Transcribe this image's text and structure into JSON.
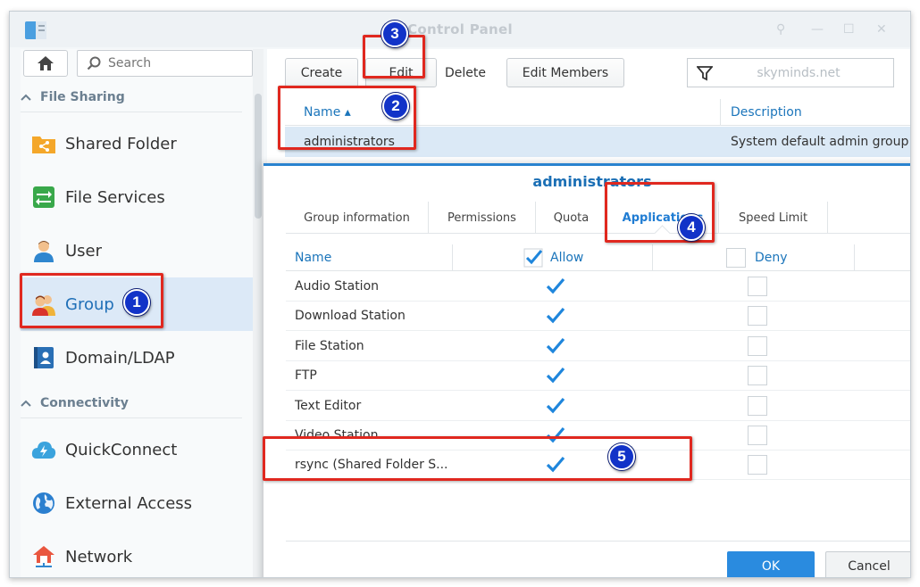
{
  "window": {
    "title": "Control Panel"
  },
  "sidebar": {
    "search_placeholder": "Search",
    "sections": [
      {
        "label": "File Sharing"
      },
      {
        "label": "Connectivity"
      }
    ],
    "items": [
      {
        "label": "Shared Folder",
        "icon": "shared-folder-icon"
      },
      {
        "label": "File Services",
        "icon": "file-services-icon"
      },
      {
        "label": "User",
        "icon": "user-icon"
      },
      {
        "label": "Group",
        "icon": "group-icon",
        "active": true
      },
      {
        "label": "Domain/LDAP",
        "icon": "domain-ldap-icon"
      },
      {
        "label": "QuickConnect",
        "icon": "quickconnect-icon"
      },
      {
        "label": "External Access",
        "icon": "globe-icon"
      },
      {
        "label": "Network",
        "icon": "network-icon"
      }
    ]
  },
  "toolbar": {
    "create": "Create",
    "edit": "Edit",
    "delete": "Delete",
    "edit_members": "Edit Members",
    "filter_value": "skyminds.net"
  },
  "group_grid": {
    "columns": {
      "name": "Name ▴",
      "description": "Description"
    },
    "rows": [
      {
        "name": "administrators",
        "description": "System default admin group"
      }
    ]
  },
  "dialog": {
    "title": "administrators",
    "tabs": [
      "Group information",
      "Permissions",
      "Quota",
      "Applications",
      "Speed Limit"
    ],
    "active_tab": "Applications",
    "columns": {
      "name": "Name",
      "allow": "Allow",
      "deny": "Deny"
    },
    "apps": [
      {
        "name": "Audio Station",
        "allow": true,
        "deny": false
      },
      {
        "name": "Download Station",
        "allow": true,
        "deny": false
      },
      {
        "name": "File Station",
        "allow": true,
        "deny": false
      },
      {
        "name": "FTP",
        "allow": true,
        "deny": false
      },
      {
        "name": "Text Editor",
        "allow": true,
        "deny": false
      },
      {
        "name": "Video Station",
        "allow": true,
        "deny": false
      },
      {
        "name": "rsync (Shared Folder S...",
        "allow": true,
        "deny": false
      }
    ],
    "ok": "OK",
    "cancel": "Cancel"
  },
  "annotations": [
    "1",
    "2",
    "3",
    "4",
    "5"
  ],
  "colors": {
    "accent": "#1f7cd3",
    "annotation_red": "#e0281f",
    "badge_blue": "#1233c8"
  }
}
